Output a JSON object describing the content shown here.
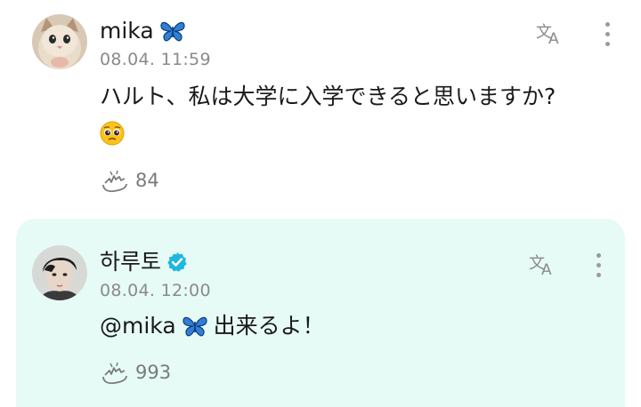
{
  "post": {
    "author": "mika",
    "author_icon": "butterfly-icon",
    "timestamp": "08.04. 11:59",
    "text_line1": "ハルト、私は大学に入学できると思いますか?",
    "text_line2_prefix": "か?",
    "emoji": "pleading-face-icon",
    "likes": "84"
  },
  "reply": {
    "author": "하루토",
    "verified_icon": "verified-badge-icon",
    "timestamp": "08.04. 12:00",
    "mention": "@mika",
    "mention_icon": "butterfly-icon",
    "text": "出来るよ！",
    "likes": "993"
  },
  "colors": {
    "reply_background": "#e7fbf6",
    "verified": "#1fb6e0",
    "butterfly": "#2f7fd6"
  }
}
